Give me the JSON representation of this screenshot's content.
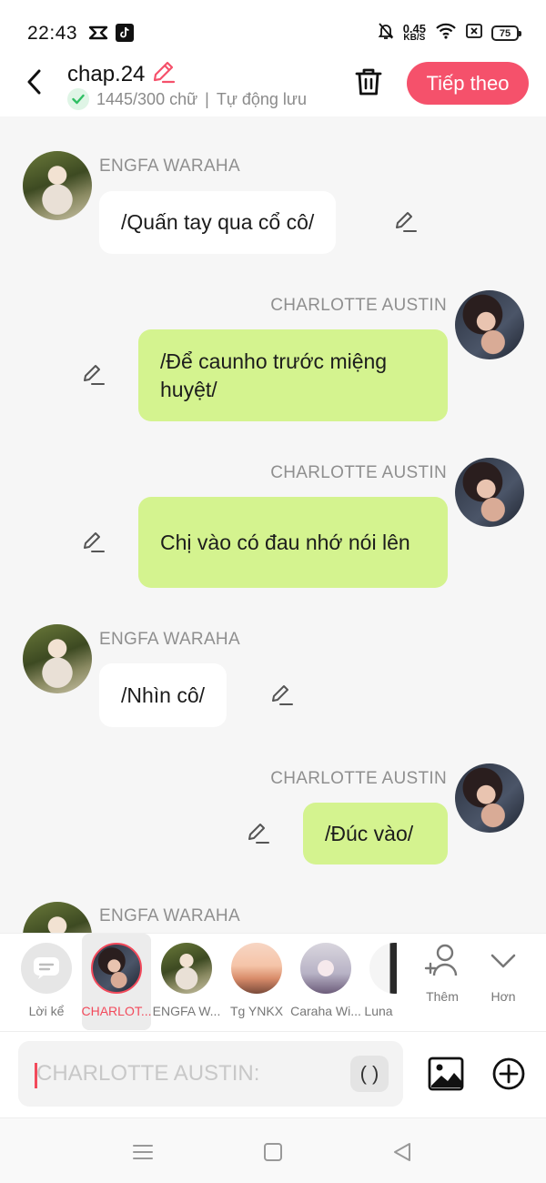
{
  "status_bar": {
    "time": "22:43",
    "network_speed": "0.45",
    "speed_unit": "KB/S",
    "battery": "75",
    "left_icons": [
      "capcut-icon",
      "tiktok-icon"
    ],
    "right_icons": [
      "mute-bell-icon",
      "wifi-icon",
      "sim-icon",
      "battery-icon"
    ]
  },
  "header": {
    "title": "chap.24",
    "word_count": "1445/300 chữ",
    "separator": "|",
    "autosave": "Tự động lưu",
    "next_button": "Tiếp theo"
  },
  "messages": [
    {
      "sender": "ENGFA WARAHA",
      "text": "/Quấn tay qua cổ cô/",
      "side": "left"
    },
    {
      "sender": "CHARLOTTE AUSTIN",
      "text": "/Để caunho trước miệng huyệt/",
      "side": "right"
    },
    {
      "sender": "CHARLOTTE AUSTIN",
      "text": "Chị vào có đau nhớ nói lên",
      "side": "right"
    },
    {
      "sender": "ENGFA WARAHA",
      "text": "/Nhìn cô/",
      "side": "left"
    },
    {
      "sender": "CHARLOTTE AUSTIN",
      "text": "/Đúc vào/",
      "side": "right"
    },
    {
      "sender": "ENGFA WARAHA",
      "text": "",
      "side": "left"
    }
  ],
  "characters": [
    {
      "name": "Lời kể",
      "selected": false
    },
    {
      "name": "CHARLOT...",
      "selected": true
    },
    {
      "name": "ENGFA W...",
      "selected": false
    },
    {
      "name": "Tg YNKX",
      "selected": false
    },
    {
      "name": "Caraha Wi...",
      "selected": false
    },
    {
      "name": "Luna",
      "selected": false
    }
  ],
  "char_actions": {
    "add": "Thêm",
    "more": "Hơn"
  },
  "input": {
    "placeholder": "CHARLOTTE AUSTIN:",
    "paren": "( )"
  },
  "colors": {
    "accent": "#f5516b",
    "right_bubble": "#d4f38f",
    "left_bubble": "#ffffff",
    "chat_bg": "#f6f6f6"
  }
}
